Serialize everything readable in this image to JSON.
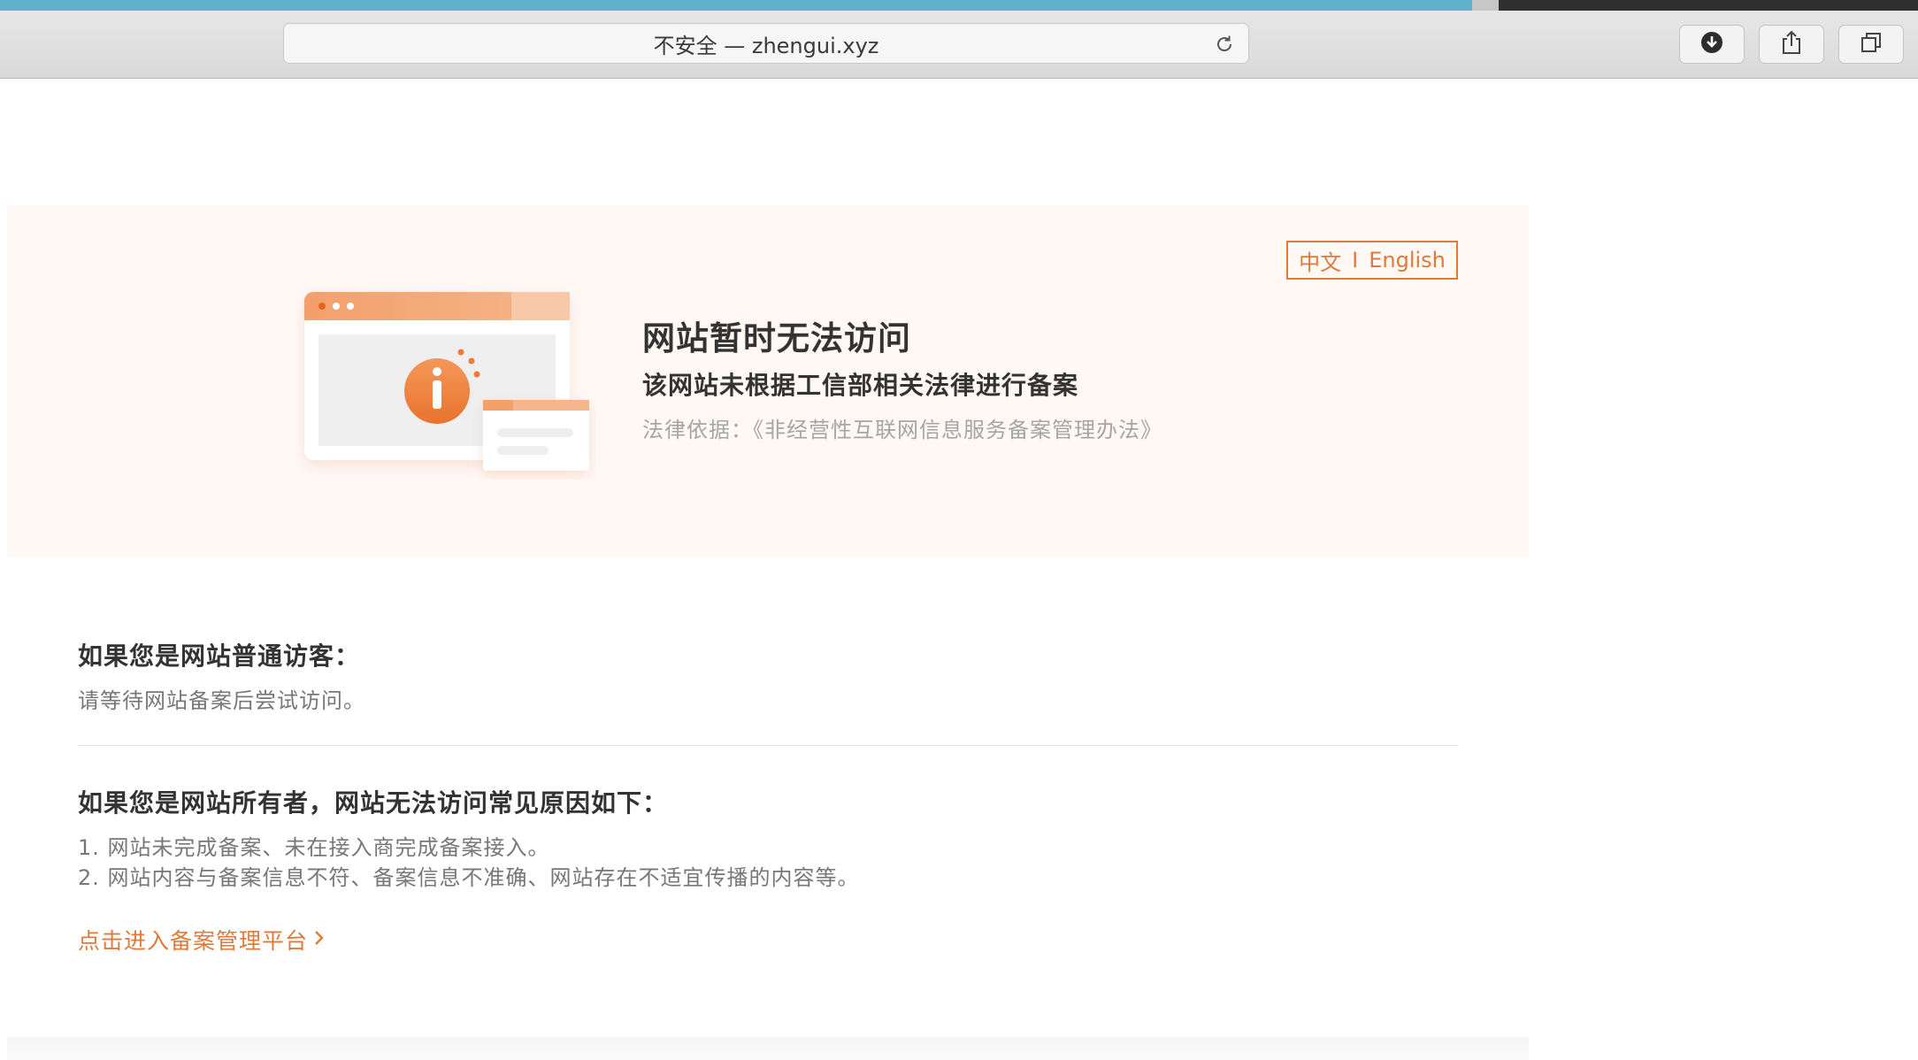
{
  "browser": {
    "address_text": "不安全 — zhengui.xyz",
    "icons": [
      "reload-icon",
      "download-icon",
      "share-icon",
      "tabs-icon"
    ]
  },
  "hero": {
    "lang_zh": "中文",
    "lang_sep": "I",
    "lang_en": "English",
    "title": "网站暂时无法访问",
    "subtitle": "该网站未根据工信部相关法律进行备案",
    "law": "法律依据：《非经营性互联网信息服务备案管理办法》"
  },
  "visitor": {
    "heading": "如果您是网站普通访客：",
    "text": "请等待网站备案后尝试访问。"
  },
  "owner": {
    "heading": "如果您是网站所有者，网站无法访问常见原因如下：",
    "reasons": [
      "1. 网站未完成备案、未在接入商完成备案接入。",
      "2. 网站内容与备案信息不符、备案信息不准确、网站存在不适宜传播的内容等。"
    ],
    "link": "点击进入备案管理平台"
  },
  "colors": {
    "accent": "#e07a3a",
    "hero_bg": "#fff8f5",
    "tab_blue": "#5fb1c9"
  }
}
